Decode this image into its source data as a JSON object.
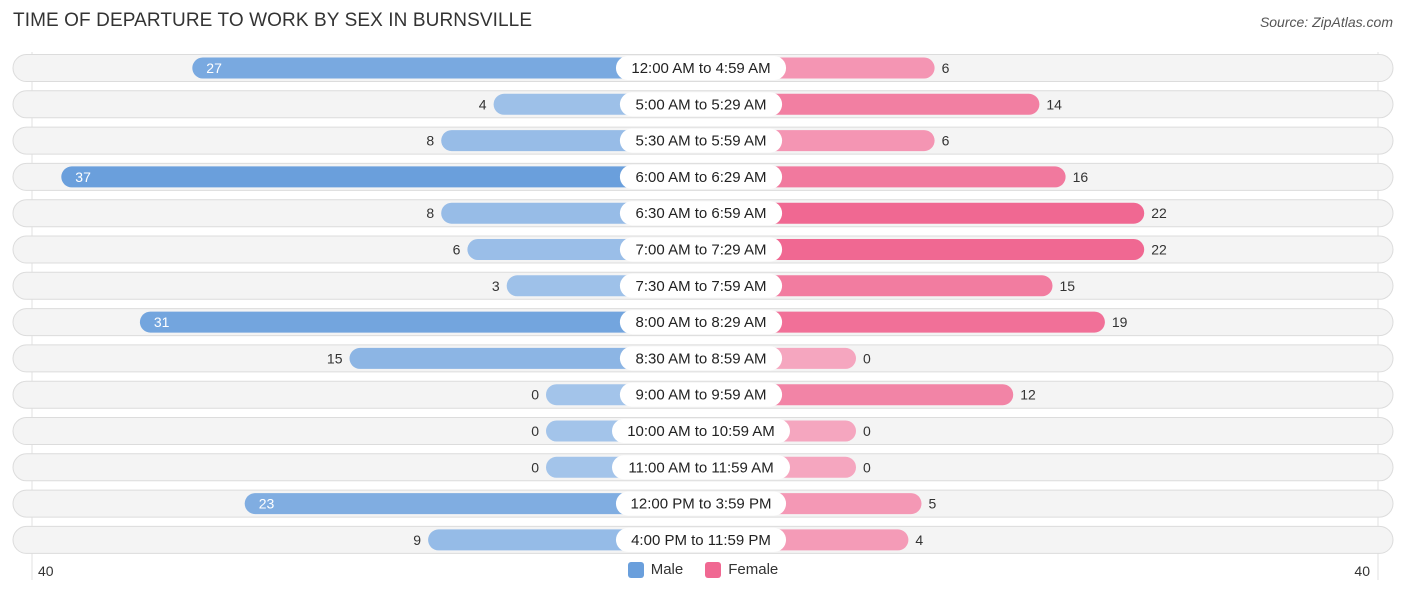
{
  "header": {
    "title": "TIME OF DEPARTURE TO WORK BY SEX IN BURNSVILLE",
    "source": "Source: ZipAtlas.com"
  },
  "colors": {
    "male_strong": "#6a9fdc",
    "male_light": "#a3c4ea",
    "female_strong": "#f06892",
    "female_light": "#f5a6bf"
  },
  "chart_data": {
    "type": "bar",
    "orientation": "horizontal-diverging",
    "title": "TIME OF DEPARTURE TO WORK BY SEX IN BURNSVILLE",
    "categories": [
      "12:00 AM to 4:59 AM",
      "5:00 AM to 5:29 AM",
      "5:30 AM to 5:59 AM",
      "6:00 AM to 6:29 AM",
      "6:30 AM to 6:59 AM",
      "7:00 AM to 7:29 AM",
      "7:30 AM to 7:59 AM",
      "8:00 AM to 8:29 AM",
      "8:30 AM to 8:59 AM",
      "9:00 AM to 9:59 AM",
      "10:00 AM to 10:59 AM",
      "11:00 AM to 11:59 AM",
      "12:00 PM to 3:59 PM",
      "4:00 PM to 11:59 PM"
    ],
    "series": [
      {
        "name": "Male",
        "values": [
          27,
          4,
          8,
          37,
          8,
          6,
          3,
          31,
          15,
          0,
          0,
          0,
          23,
          9
        ]
      },
      {
        "name": "Female",
        "values": [
          6,
          14,
          6,
          16,
          22,
          22,
          15,
          19,
          0,
          12,
          0,
          0,
          5,
          4
        ]
      }
    ],
    "xlim": [
      -40,
      40
    ],
    "axis_labels": {
      "left": "40",
      "right": "40"
    },
    "legend": {
      "position": "bottom-center",
      "entries": [
        "Male",
        "Female"
      ]
    },
    "grid": false
  }
}
